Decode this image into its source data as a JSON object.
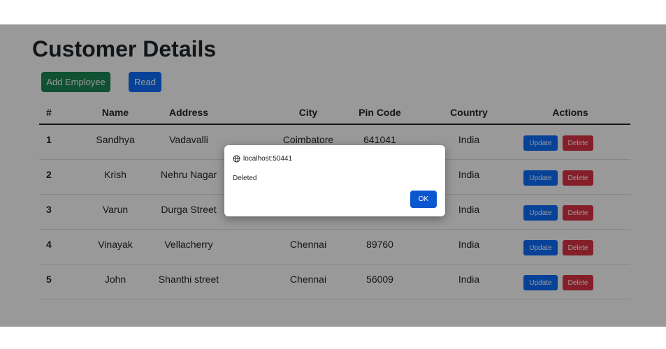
{
  "page": {
    "title": "Customer Details"
  },
  "toolbar": {
    "add_label": "Add Employee",
    "read_label": "Read"
  },
  "table": {
    "headers": [
      "#",
      "Name",
      "Address",
      "City",
      "Pin Code",
      "Country",
      "Actions"
    ],
    "rows": [
      {
        "num": "1",
        "name": "Sandhya",
        "address": "Vadavalli",
        "city": "Coimbatore",
        "pin": "641041",
        "country": "India"
      },
      {
        "num": "2",
        "name": "Krish",
        "address": "Nehru Nagar",
        "city": "",
        "pin": "",
        "country": "India"
      },
      {
        "num": "3",
        "name": "Varun",
        "address": "Durga Street",
        "city": "",
        "pin": "",
        "country": "India"
      },
      {
        "num": "4",
        "name": "Vinayak",
        "address": "Vellacherry",
        "city": "Chennai",
        "pin": "89760",
        "country": "India"
      },
      {
        "num": "5",
        "name": "John",
        "address": "Shanthi street",
        "city": "Chennai",
        "pin": "56009",
        "country": "India"
      }
    ],
    "update_label": "Update",
    "delete_label": "Delete"
  },
  "dialog": {
    "origin": "localhost:50441",
    "message": "Deleted",
    "ok_label": "OK"
  },
  "colors": {
    "success": "#198754",
    "primary": "#0d6efd",
    "danger": "#dc3545",
    "dialog_ok": "#0b57d0"
  }
}
